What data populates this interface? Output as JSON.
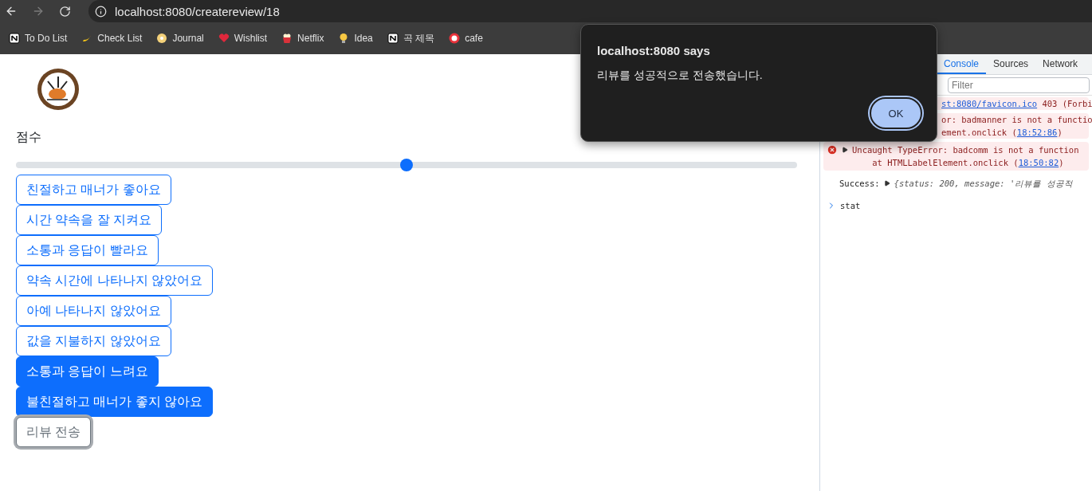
{
  "browser": {
    "url": "localhost:8080/createreview/18",
    "bookmarks": [
      {
        "label": "To Do List"
      },
      {
        "label": "Check List"
      },
      {
        "label": "Journal"
      },
      {
        "label": "Wishlist"
      },
      {
        "label": "Netflix"
      },
      {
        "label": "Idea"
      },
      {
        "label": "곡 제목"
      },
      {
        "label": "cafe"
      }
    ]
  },
  "page": {
    "score_label": "점수",
    "score_slider": {
      "level": 0.5
    },
    "tags": [
      {
        "label": "친절하고 매너가 좋아요",
        "selected": false
      },
      {
        "label": "시간 약속을 잘 지켜요",
        "selected": false
      },
      {
        "label": "소통과 응답이 빨라요",
        "selected": false
      },
      {
        "label": "약속 시간에 나타나지 않았어요",
        "selected": false
      },
      {
        "label": "아예 나타나지 않았어요",
        "selected": false
      },
      {
        "label": "값을 지불하지 않았어요",
        "selected": false
      },
      {
        "label": "소통과 응답이 느려요",
        "selected": true
      },
      {
        "label": "불친절하고 매너가 좋지 않아요",
        "selected": true
      }
    ],
    "submit_button": "리뷰 전송"
  },
  "devtools": {
    "tabs": [
      {
        "label": "Console",
        "selected": true
      },
      {
        "label": "Sources",
        "selected": false
      },
      {
        "label": "Network",
        "selected": false
      }
    ],
    "filter_placeholder": "Filter",
    "messages": [
      {
        "kind": "error_tail",
        "lines": [
          [
            {
              "t": "st:8080/favicon.ico",
              "kind": "link"
            },
            {
              "t": " 403 (Forbi",
              "kind": "plain"
            }
          ]
        ]
      },
      {
        "kind": "error_tail",
        "lines": [
          [
            {
              "t": "or: badmanner is not a functio",
              "kind": "plain"
            }
          ],
          [
            {
              "t": "ement.onclick (",
              "kind": "plain"
            },
            {
              "t": "18:52:86",
              "kind": "link"
            },
            {
              "t": ")",
              "kind": "plain"
            }
          ]
        ]
      },
      {
        "kind": "error",
        "lines": [
          [
            {
              "t": "Uncaught TypeError: badcomm is not a function",
              "kind": "plain"
            }
          ],
          [
            {
              "t": "    at HTMLLabelElement.onclick (",
              "kind": "plain"
            },
            {
              "t": "18:50:82",
              "kind": "link"
            },
            {
              "t": ")",
              "kind": "plain"
            }
          ]
        ]
      },
      {
        "kind": "log",
        "label": "Success:",
        "object": "{status: 200, message: '리뷰를 성공적"
      },
      {
        "kind": "input",
        "text": "stat"
      }
    ]
  },
  "dialog": {
    "title": "localhost:8080 says",
    "message": "리뷰를 성공적으로 전송했습니다.",
    "button": "OK"
  }
}
